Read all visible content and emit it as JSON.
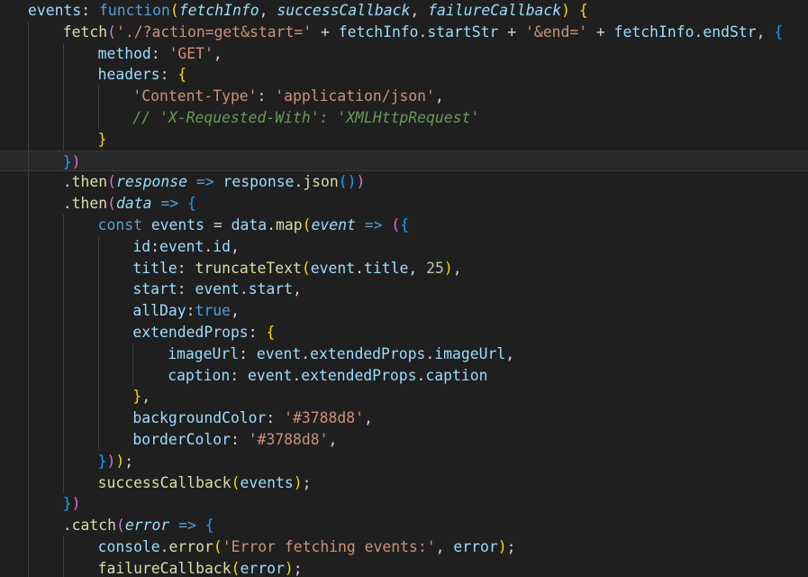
{
  "editor": {
    "language": "javascript",
    "theme": "dark",
    "active_line_index": 7,
    "colors": {
      "background": "#1f1f1f",
      "keyword": "#569cd6",
      "function": "#dcdcaa",
      "variable": "#9cdcfe",
      "string": "#ce9178",
      "number": "#b5cea8",
      "comment": "#6a9955",
      "bracket_1": "#ffd700",
      "bracket_2": "#da70d6",
      "bracket_3": "#179fff"
    },
    "lines": [
      {
        "indent": 0,
        "tokens": [
          [
            "v",
            "events"
          ],
          [
            "o",
            ": "
          ],
          [
            "k",
            "function"
          ],
          [
            "b1",
            "("
          ],
          [
            "p",
            "fetchInfo"
          ],
          [
            "o",
            ", "
          ],
          [
            "p",
            "successCallback"
          ],
          [
            "o",
            ", "
          ],
          [
            "p",
            "failureCallback"
          ],
          [
            "b1",
            ")"
          ],
          [
            "o",
            " "
          ],
          [
            "b1",
            "{"
          ]
        ]
      },
      {
        "indent": 1,
        "tokens": [
          [
            "f",
            "fetch"
          ],
          [
            "b2",
            "("
          ],
          [
            "s",
            "'./?action=get&start='"
          ],
          [
            "o",
            " + "
          ],
          [
            "v",
            "fetchInfo"
          ],
          [
            "o",
            "."
          ],
          [
            "v",
            "startStr"
          ],
          [
            "o",
            " + "
          ],
          [
            "s",
            "'&end='"
          ],
          [
            "o",
            " + "
          ],
          [
            "v",
            "fetchInfo"
          ],
          [
            "o",
            "."
          ],
          [
            "v",
            "endStr"
          ],
          [
            "o",
            ", "
          ],
          [
            "b3",
            "{"
          ]
        ]
      },
      {
        "indent": 2,
        "tokens": [
          [
            "v",
            "method"
          ],
          [
            "o",
            ": "
          ],
          [
            "s",
            "'GET'"
          ],
          [
            "o",
            ","
          ]
        ]
      },
      {
        "indent": 2,
        "tokens": [
          [
            "v",
            "headers"
          ],
          [
            "o",
            ": "
          ],
          [
            "b1",
            "{"
          ]
        ]
      },
      {
        "indent": 3,
        "tokens": [
          [
            "s",
            "'Content-Type'"
          ],
          [
            "o",
            ": "
          ],
          [
            "s",
            "'application/json'"
          ],
          [
            "o",
            ","
          ]
        ]
      },
      {
        "indent": 3,
        "tokens": [
          [
            "c",
            "// 'X-Requested-With': 'XMLHttpRequest'"
          ]
        ]
      },
      {
        "indent": 2,
        "tokens": [
          [
            "b1",
            "}"
          ]
        ]
      },
      {
        "indent": 1,
        "tokens": [
          [
            "b3",
            "}"
          ],
          [
            "b2",
            ")"
          ]
        ]
      },
      {
        "indent": 1,
        "tokens": [
          [
            "o",
            "."
          ],
          [
            "f",
            "then"
          ],
          [
            "b2",
            "("
          ],
          [
            "p",
            "response"
          ],
          [
            "o",
            " "
          ],
          [
            "k",
            "=>"
          ],
          [
            "o",
            " "
          ],
          [
            "v",
            "response"
          ],
          [
            "o",
            "."
          ],
          [
            "f",
            "json"
          ],
          [
            "b3",
            "("
          ],
          [
            "b3",
            ")"
          ],
          [
            "b2",
            ")"
          ]
        ]
      },
      {
        "indent": 1,
        "tokens": [
          [
            "o",
            "."
          ],
          [
            "f",
            "then"
          ],
          [
            "b2",
            "("
          ],
          [
            "p",
            "data"
          ],
          [
            "o",
            " "
          ],
          [
            "k",
            "=>"
          ],
          [
            "o",
            " "
          ],
          [
            "b3",
            "{"
          ]
        ]
      },
      {
        "indent": 2,
        "tokens": [
          [
            "k",
            "const"
          ],
          [
            "o",
            " "
          ],
          [
            "v",
            "events"
          ],
          [
            "o",
            " = "
          ],
          [
            "v",
            "data"
          ],
          [
            "o",
            "."
          ],
          [
            "f",
            "map"
          ],
          [
            "b1",
            "("
          ],
          [
            "p",
            "event"
          ],
          [
            "o",
            " "
          ],
          [
            "k",
            "=>"
          ],
          [
            "o",
            " "
          ],
          [
            "b2",
            "("
          ],
          [
            "b3",
            "{"
          ]
        ]
      },
      {
        "indent": 3,
        "tokens": [
          [
            "v",
            "id"
          ],
          [
            "o",
            ":"
          ],
          [
            "v",
            "event"
          ],
          [
            "o",
            "."
          ],
          [
            "v",
            "id"
          ],
          [
            "o",
            ","
          ]
        ]
      },
      {
        "indent": 3,
        "tokens": [
          [
            "v",
            "title"
          ],
          [
            "o",
            ": "
          ],
          [
            "f",
            "truncateText"
          ],
          [
            "b1",
            "("
          ],
          [
            "v",
            "event"
          ],
          [
            "o",
            "."
          ],
          [
            "v",
            "title"
          ],
          [
            "o",
            ", "
          ],
          [
            "n",
            "25"
          ],
          [
            "b1",
            ")"
          ],
          [
            "o",
            ","
          ]
        ]
      },
      {
        "indent": 3,
        "tokens": [
          [
            "v",
            "start"
          ],
          [
            "o",
            ": "
          ],
          [
            "v",
            "event"
          ],
          [
            "o",
            "."
          ],
          [
            "v",
            "start"
          ],
          [
            "o",
            ","
          ]
        ]
      },
      {
        "indent": 3,
        "tokens": [
          [
            "v",
            "allDay"
          ],
          [
            "o",
            ":"
          ],
          [
            "k",
            "true"
          ],
          [
            "o",
            ","
          ]
        ]
      },
      {
        "indent": 3,
        "tokens": [
          [
            "v",
            "extendedProps"
          ],
          [
            "o",
            ": "
          ],
          [
            "b1",
            "{"
          ]
        ]
      },
      {
        "indent": 4,
        "tokens": [
          [
            "v",
            "imageUrl"
          ],
          [
            "o",
            ": "
          ],
          [
            "v",
            "event"
          ],
          [
            "o",
            "."
          ],
          [
            "v",
            "extendedProps"
          ],
          [
            "o",
            "."
          ],
          [
            "v",
            "imageUrl"
          ],
          [
            "o",
            ","
          ]
        ]
      },
      {
        "indent": 4,
        "tokens": [
          [
            "v",
            "caption"
          ],
          [
            "o",
            ": "
          ],
          [
            "v",
            "event"
          ],
          [
            "o",
            "."
          ],
          [
            "v",
            "extendedProps"
          ],
          [
            "o",
            "."
          ],
          [
            "v",
            "caption"
          ]
        ]
      },
      {
        "indent": 3,
        "tokens": [
          [
            "b1",
            "}"
          ],
          [
            "o",
            ","
          ]
        ]
      },
      {
        "indent": 3,
        "tokens": [
          [
            "v",
            "backgroundColor"
          ],
          [
            "o",
            ": "
          ],
          [
            "s",
            "'#3788d8'"
          ],
          [
            "o",
            ","
          ]
        ]
      },
      {
        "indent": 3,
        "tokens": [
          [
            "v",
            "borderColor"
          ],
          [
            "o",
            ": "
          ],
          [
            "s",
            "'#3788d8'"
          ],
          [
            "o",
            ","
          ]
        ]
      },
      {
        "indent": 2,
        "tokens": [
          [
            "b3",
            "}"
          ],
          [
            "b2",
            ")"
          ],
          [
            "b1",
            ")"
          ],
          [
            "o",
            ";"
          ]
        ]
      },
      {
        "indent": 2,
        "tokens": [
          [
            "f",
            "successCallback"
          ],
          [
            "b1",
            "("
          ],
          [
            "v",
            "events"
          ],
          [
            "b1",
            ")"
          ],
          [
            "o",
            ";"
          ]
        ]
      },
      {
        "indent": 1,
        "tokens": [
          [
            "b3",
            "}"
          ],
          [
            "b2",
            ")"
          ]
        ]
      },
      {
        "indent": 1,
        "tokens": [
          [
            "o",
            "."
          ],
          [
            "f",
            "catch"
          ],
          [
            "b2",
            "("
          ],
          [
            "p",
            "error"
          ],
          [
            "o",
            " "
          ],
          [
            "k",
            "=>"
          ],
          [
            "o",
            " "
          ],
          [
            "b3",
            "{"
          ]
        ]
      },
      {
        "indent": 2,
        "tokens": [
          [
            "v",
            "console"
          ],
          [
            "o",
            "."
          ],
          [
            "f",
            "error"
          ],
          [
            "b1",
            "("
          ],
          [
            "s",
            "'Error fetching events:'"
          ],
          [
            "o",
            ", "
          ],
          [
            "v",
            "error"
          ],
          [
            "b1",
            ")"
          ],
          [
            "o",
            ";"
          ]
        ]
      },
      {
        "indent": 2,
        "tokens": [
          [
            "f",
            "failureCallback"
          ],
          [
            "b1",
            "("
          ],
          [
            "v",
            "error"
          ],
          [
            "b1",
            ")"
          ],
          [
            "o",
            ";"
          ]
        ]
      }
    ]
  }
}
